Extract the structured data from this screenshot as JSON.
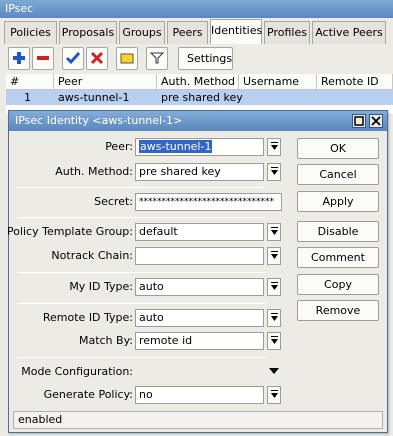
{
  "window": {
    "title": "IPsec"
  },
  "tabs": [
    "Policies",
    "Proposals",
    "Groups",
    "Peers",
    "Identities",
    "Profiles",
    "Active Peers"
  ],
  "active_tab": "Identities",
  "toolbar": {
    "settings_label": "Settings"
  },
  "list": {
    "columns": [
      "#",
      "Peer",
      "Auth. Method",
      "Username",
      "Remote ID"
    ],
    "rows": [
      {
        "num": "1",
        "peer": "aws-tunnel-1",
        "auth_method": "pre shared key",
        "username": "",
        "remote_id": ""
      }
    ]
  },
  "dialog": {
    "title": "IPsec Identity <aws-tunnel-1>",
    "fields": {
      "peer": {
        "label": "Peer:",
        "value": "aws-tunnel-1"
      },
      "auth_method": {
        "label": "Auth. Method:",
        "value": "pre shared key"
      },
      "secret": {
        "label": "Secret:",
        "value": "******************************"
      },
      "policy_template_group": {
        "label": "Policy Template Group:",
        "value": "default"
      },
      "notrack_chain": {
        "label": "Notrack Chain:",
        "value": ""
      },
      "my_id_type": {
        "label": "My ID Type:",
        "value": "auto"
      },
      "remote_id_type": {
        "label": "Remote ID Type:",
        "value": "auto"
      },
      "match_by": {
        "label": "Match By:",
        "value": "remote id"
      },
      "mode_configuration": {
        "label": "Mode Configuration:",
        "value": ""
      },
      "generate_policy": {
        "label": "Generate Policy:",
        "value": "no"
      }
    },
    "buttons": {
      "ok": "OK",
      "cancel": "Cancel",
      "apply": "Apply",
      "disable": "Disable",
      "comment": "Comment",
      "copy": "Copy",
      "remove": "Remove"
    },
    "status": "enabled"
  },
  "colors": {
    "title_bar": "#5b88c0",
    "selected_row": "#b9cff0",
    "add_icon": "#1c57c8",
    "remove_icon": "#cc2222",
    "enable_icon": "#1c57c8",
    "disable_icon": "#cc2222",
    "comment_icon": "#f2d43a"
  }
}
